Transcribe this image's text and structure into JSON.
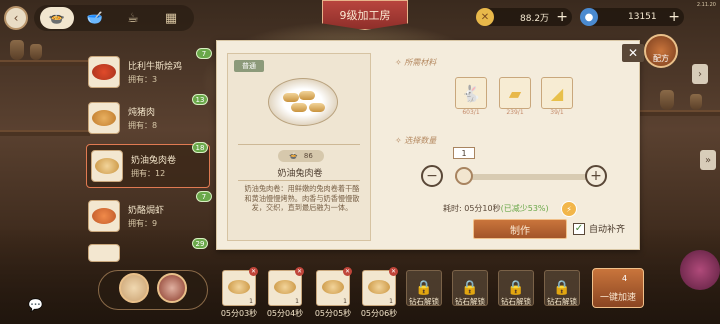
{
  "header": {
    "title": "9级加工房",
    "gold": "88.2万",
    "gems": "13151",
    "version": "2.11.20"
  },
  "recipes": [
    {
      "name": "比利牛斯烩鸡",
      "owned": "拥有：3",
      "level": "7"
    },
    {
      "name": "炖猪肉",
      "owned": "拥有：8",
      "level": "13"
    },
    {
      "name": "奶油兔肉卷",
      "owned": "拥有：12",
      "level": "18"
    },
    {
      "name": "奶酪焗虾",
      "owned": "拥有：9",
      "level": "7"
    },
    {
      "name": "",
      "owned": "",
      "level": "29"
    }
  ],
  "detail": {
    "quality": "普通",
    "pot_count": "86",
    "dish_name": "奶油兔肉卷",
    "description": "奶油兔肉卷：用鲜嫩的兔肉卷着干酪和黄油慢慢烤熟。肉香与奶香慢慢散发，交织，直到最后融为一体。",
    "materials_label": "所需材料",
    "materials": [
      {
        "icon": "rabbit-icon",
        "count": "603/1"
      },
      {
        "icon": "butter-icon",
        "count": "239/1"
      },
      {
        "icon": "cheese-icon",
        "count": "39/1"
      }
    ],
    "qty_label": "选择数量",
    "qty": "1",
    "time_prefix": "耗时: 05分10秒",
    "time_reduce": "(已减少53%)",
    "make_label": "制作",
    "auto_refill_label": "自动补齐",
    "recipe_book_label": "配方"
  },
  "queue": [
    {
      "count": "1",
      "time": "05分03秒"
    },
    {
      "count": "1",
      "time": "05分04秒"
    },
    {
      "count": "1",
      "time": "05分05秒"
    },
    {
      "count": "1",
      "time": "05分06秒"
    }
  ],
  "locked_slots": [
    "钻石解锁",
    "钻石解锁",
    "钻石解锁",
    "钻石解锁"
  ],
  "speed_up": {
    "label": "一键加速",
    "count": "4"
  },
  "colors": {
    "accent": "#c9753c",
    "panel": "#f4ecdc",
    "badge": "#6aa84a",
    "banner": "#b8453e"
  }
}
